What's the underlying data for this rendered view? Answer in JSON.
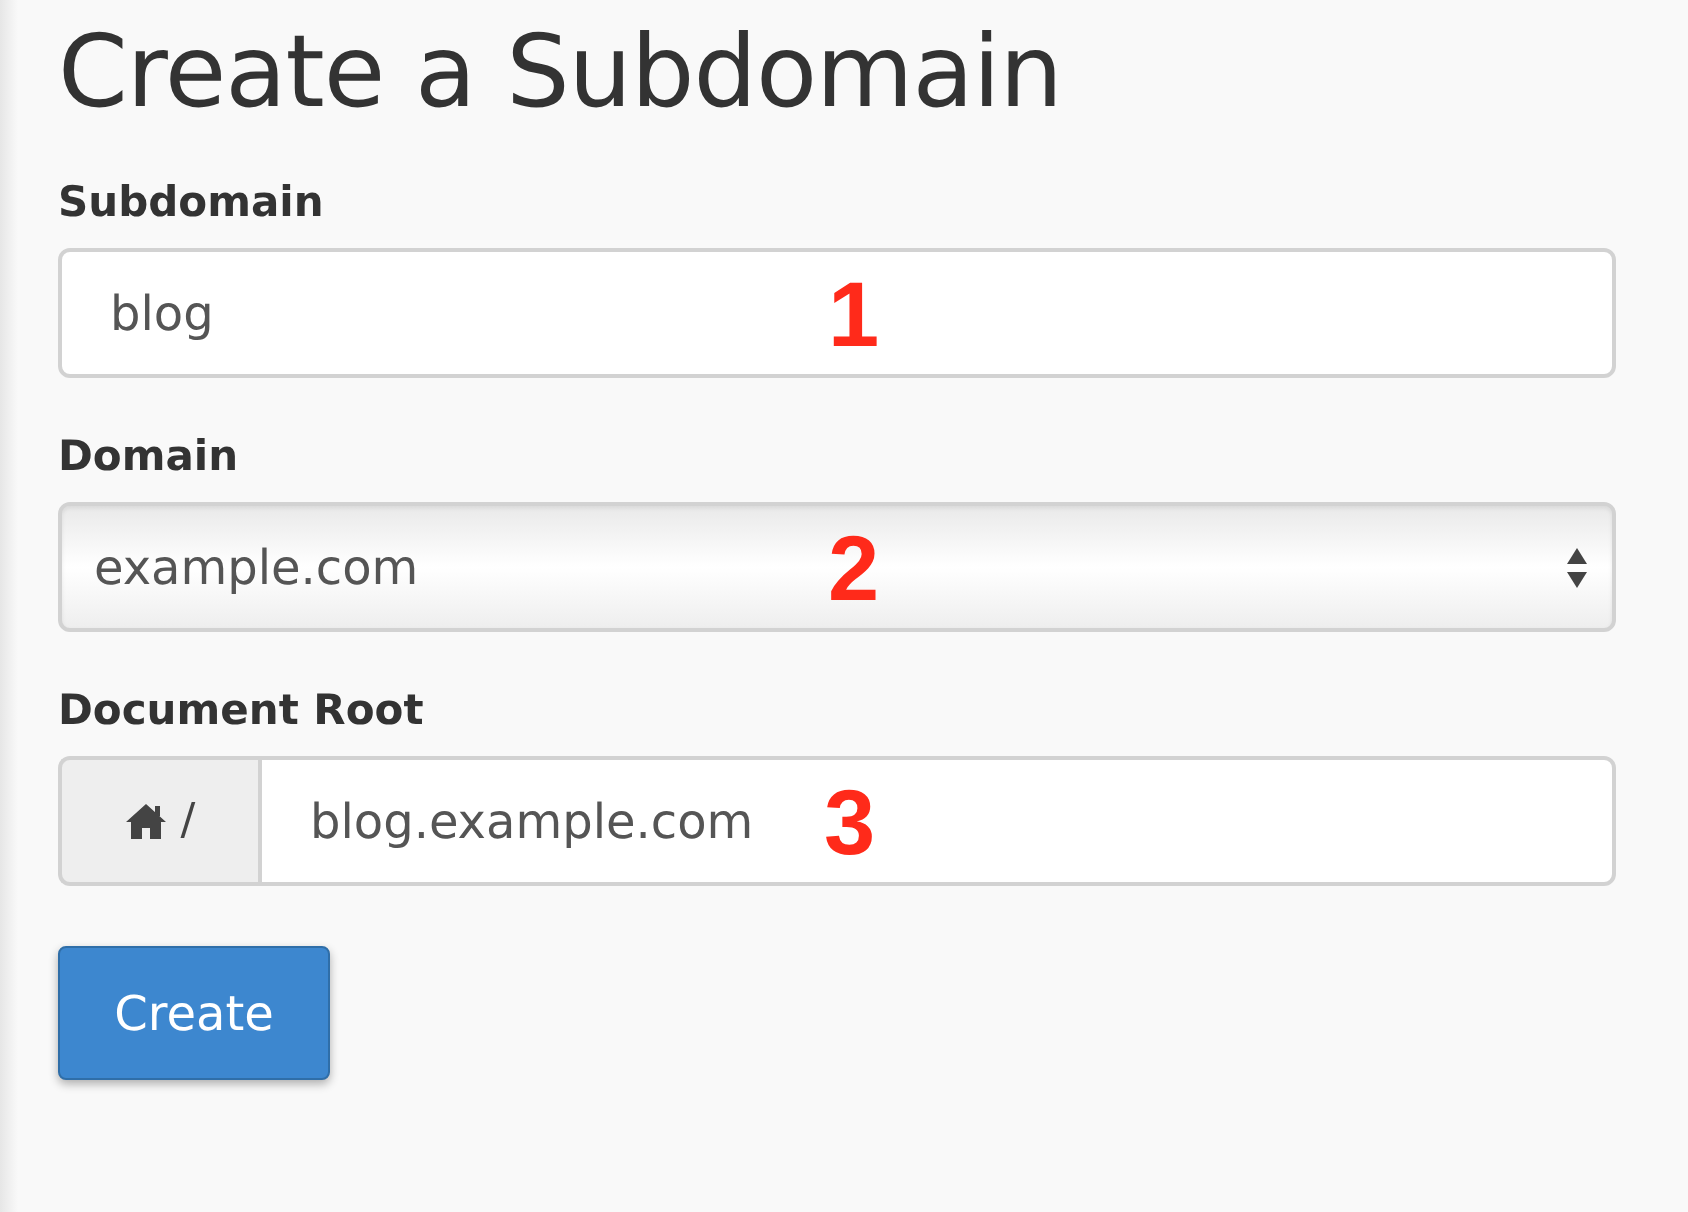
{
  "title": "Create a Subdomain",
  "fields": [
    {
      "kind": "text",
      "label": "Subdomain",
      "value": "blog",
      "callout": "1"
    },
    {
      "kind": "select",
      "label": "Domain",
      "value": "example.com",
      "callout": "2"
    },
    {
      "kind": "prefixed",
      "label": "Document Root",
      "prefix": "/",
      "value": "blog.example.com",
      "callout": "3"
    }
  ],
  "button": "Create"
}
